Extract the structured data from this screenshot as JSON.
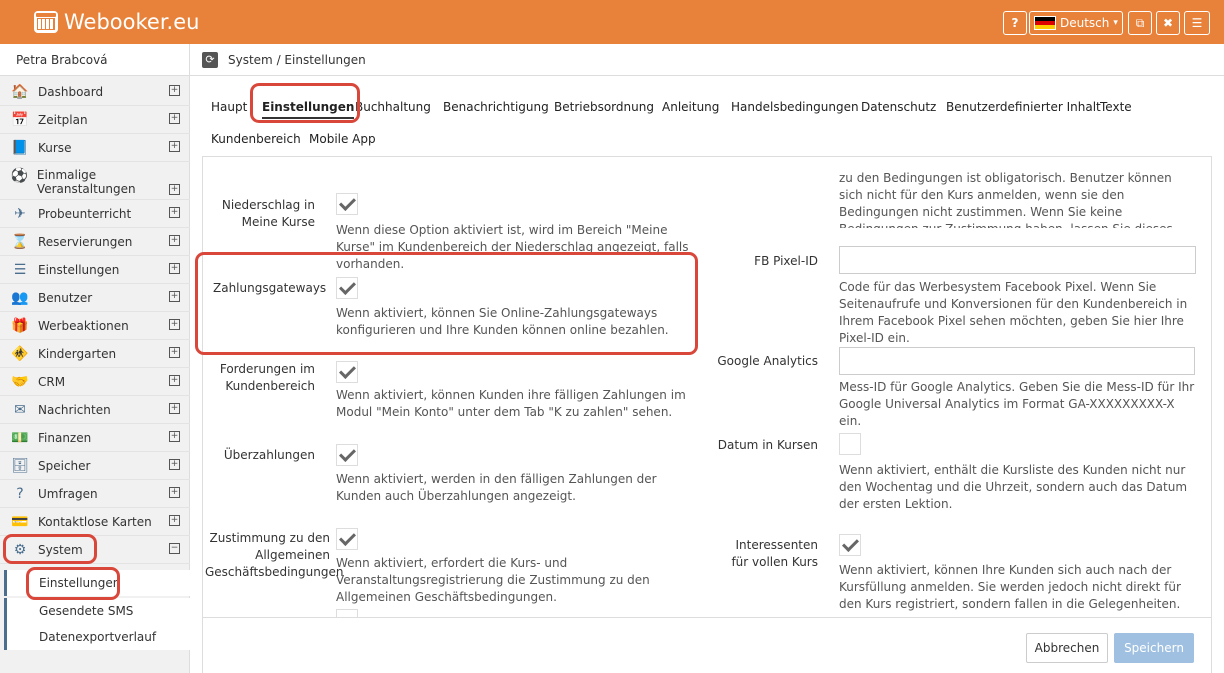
{
  "topbar": {
    "logo": "Webooker.eu",
    "help": "?",
    "language": "Deutsch",
    "caret": "▾",
    "external": "⧉",
    "close": "✖",
    "menu": "☰"
  },
  "sidebar": {
    "user": "Petra Brabcová",
    "items": [
      {
        "label": "Dashboard",
        "icon": "🏠",
        "expander": "+"
      },
      {
        "label": "Zeitplan",
        "icon": "📅",
        "expander": "+"
      },
      {
        "label": "Kurse",
        "icon": "📘",
        "expander": "+"
      },
      {
        "label": "Einmalige Veranstaltungen",
        "icon": "⚽",
        "expander": "+"
      },
      {
        "label": "Probeunterricht",
        "icon": "✈",
        "expander": "+"
      },
      {
        "label": "Reservierungen",
        "icon": "⌛",
        "expander": "+"
      },
      {
        "label": "Einstellungen",
        "icon": "☰",
        "expander": "+"
      },
      {
        "label": "Benutzer",
        "icon": "👥",
        "expander": "+"
      },
      {
        "label": "Werbeaktionen",
        "icon": "🎁",
        "expander": "+"
      },
      {
        "label": "Kindergarten",
        "icon": "🚸",
        "expander": "+"
      },
      {
        "label": "CRM",
        "icon": "🤝",
        "expander": "+"
      },
      {
        "label": "Nachrichten",
        "icon": "✉",
        "expander": "+"
      },
      {
        "label": "Finanzen",
        "icon": "💵",
        "expander": "+"
      },
      {
        "label": "Speicher",
        "icon": "🗄",
        "expander": "+"
      },
      {
        "label": "Umfragen",
        "icon": "?",
        "expander": "+"
      },
      {
        "label": "Kontaktlose Karten",
        "icon": "💳",
        "expander": "+"
      },
      {
        "label": "System",
        "icon": "⚙",
        "expander": "−"
      }
    ],
    "subitems": [
      "Einstellungen",
      "Gesendete SMS",
      "Datenexportverlauf"
    ]
  },
  "breadcrumb": {
    "refresh": "⟳",
    "text": "System / Einstellungen"
  },
  "tabs": [
    "Haupt",
    "Einstellungen",
    "Buchhaltung",
    "Benachrichtigung",
    "Betriebsordnung",
    "Anleitung",
    "Handelsbedingungen",
    "Datenschutz",
    "Benutzerdefinierter Inhalt",
    "Texte",
    "Kundenbereich",
    "Mobile App"
  ],
  "left_settings": [
    {
      "label": "Niederschlag in Meine Kurse",
      "checked": true,
      "desc": "Wenn diese Option aktiviert ist, wird im Bereich \"Meine Kurse\" im Kundenbereich der Niederschlag angezeigt, falls vorhanden."
    },
    {
      "label": "Zahlungsgateways",
      "checked": true,
      "desc": "Wenn aktiviert, können Sie Online-Zahlungsgateways konfigurieren und Ihre Kunden können online bezahlen."
    },
    {
      "label": "Forderungen im Kundenbereich",
      "checked": true,
      "desc": "Wenn aktiviert, können Kunden ihre fälligen Zahlungen im Modul \"Mein Konto\" unter dem Tab \"K zu zahlen\" sehen."
    },
    {
      "label": "Überzahlungen",
      "checked": true,
      "desc": "Wenn aktiviert, werden in den fälligen Zahlungen der Kunden auch Überzahlungen angezeigt."
    },
    {
      "label": "Zustimmung zu den Allgemeinen Geschäftsbedingungen",
      "checked": true,
      "desc": "Wenn aktiviert, erfordert die Kurs- und Veranstaltungsregistrierung die Zustimmung zu den Allgemeinen Geschäftsbedingungen."
    }
  ],
  "right_top_desc": "zu den Bedingungen ist obligatorisch. Benutzer können sich nicht für den Kurs anmelden, wenn sie den Bedingungen nicht zustimmen. Wenn Sie keine Bedingungen zur Zustimmung haben, lassen Sie dieses Feld leer.",
  "right_settings": [
    {
      "label": "FB Pixel-ID",
      "value": "",
      "desc": "Code für das Werbesystem Facebook Pixel. Wenn Sie Seitenaufrufe und Konversionen für den Kundenbereich in Ihrem Facebook Pixel sehen möchten, geben Sie hier Ihre Pixel-ID ein."
    },
    {
      "label": "Google Analytics",
      "value": "",
      "desc": "Mess-ID für Google Analytics. Geben Sie die Mess-ID für Ihr Google Universal Analytics im Format GA-XXXXXXXXX-X ein."
    },
    {
      "label": "Datum in Kursen",
      "checked": false,
      "desc": "Wenn aktiviert, enthält die Kursliste des Kunden nicht nur den Wochentag und die Uhrzeit, sondern auch das Datum der ersten Lektion."
    },
    {
      "label": "Interessenten für vollen Kurs",
      "checked": true,
      "desc": "Wenn aktiviert, können Ihre Kunden sich auch nach der Kursfüllung anmelden. Sie werden jedoch nicht direkt für den Kurs registriert, sondern fallen in die Gelegenheiten."
    }
  ],
  "buttons": {
    "cancel": "Abbrechen",
    "save": "Speichern"
  },
  "colors": {
    "topbar": "#e8823a",
    "highlight": "#d9473b",
    "save": "#9fc0e0"
  }
}
